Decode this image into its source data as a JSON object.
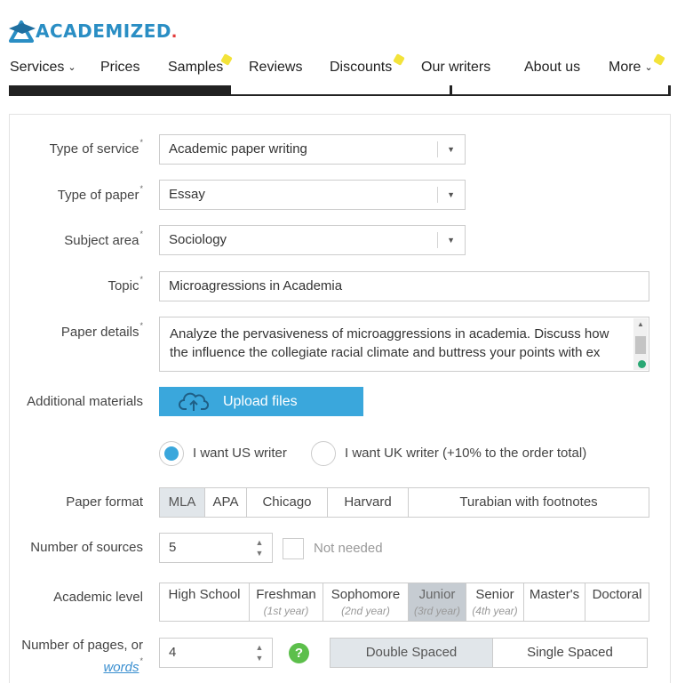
{
  "logo": {
    "text": "ACADEMIZED",
    "dot": "."
  },
  "nav": {
    "items": [
      {
        "label": "Services",
        "has_chevron": true
      },
      {
        "label": "Prices"
      },
      {
        "label": "Samples",
        "has_spark": true
      },
      {
        "label": "Reviews"
      },
      {
        "label": "Discounts",
        "has_spark": true
      },
      {
        "label": "Our writers"
      },
      {
        "label": "About us"
      },
      {
        "label": "More",
        "has_chevron": true,
        "has_spark": true
      }
    ],
    "chevron_icon": "chevron-down-icon",
    "spark_icon": "sparkle-icon"
  },
  "form": {
    "type_of_service": {
      "label": "Type of service",
      "value": "Academic paper writing"
    },
    "type_of_paper": {
      "label": "Type of paper",
      "value": "Essay"
    },
    "subject_area": {
      "label": "Subject area",
      "value": "Sociology"
    },
    "topic": {
      "label": "Topic",
      "value": "Microagressions in Academia"
    },
    "paper_details": {
      "label": "Paper details",
      "line1": "Analyze the pervasiveness of microaggressions in academia. Discuss how",
      "line2": "the influence the collegiate racial climate and buttress your points with ex"
    },
    "additional_materials": {
      "label": "Additional materials",
      "button": "Upload files",
      "icon": "cloud-upload-icon"
    },
    "writer": {
      "us": {
        "label": "I want US writer",
        "selected": true
      },
      "uk": {
        "label": "I want UK writer (+10% to the order total)",
        "selected": false
      }
    },
    "paper_format": {
      "label": "Paper format",
      "options": [
        "MLA",
        "APA",
        "Chicago",
        "Harvard",
        "Turabian with footnotes"
      ],
      "selected": "MLA"
    },
    "number_of_sources": {
      "label": "Number of sources",
      "value": "5",
      "not_needed": "Not needed"
    },
    "academic_level": {
      "label": "Academic level",
      "options": [
        {
          "title": "High School",
          "sub": ""
        },
        {
          "title": "Freshman",
          "sub": "(1st year)"
        },
        {
          "title": "Sophomore",
          "sub": "(2nd year)"
        },
        {
          "title": "Junior",
          "sub": "(3rd year)"
        },
        {
          "title": "Senior",
          "sub": "(4th year)"
        },
        {
          "title": "Master's",
          "sub": ""
        },
        {
          "title": "Doctoral",
          "sub": ""
        }
      ],
      "selected": "Junior"
    },
    "pages": {
      "label_line1": "Number of pages, or",
      "label_link": "words",
      "value": "4",
      "help": "?",
      "spacing": [
        "Double Spaced",
        "Single Spaced"
      ],
      "selected_spacing": "Double Spaced"
    },
    "required_mark": "*",
    "dropdown_arrow": "▼"
  },
  "colors": {
    "accent": "#3aa7dc",
    "brand": "#2a8ec4",
    "help_green": "#5cbf4b",
    "logo_dot": "#e23a3a"
  }
}
